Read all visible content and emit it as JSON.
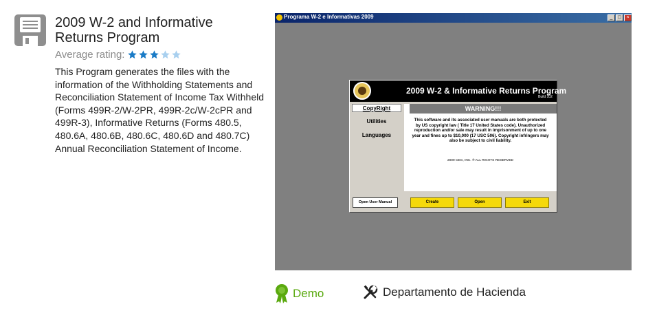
{
  "app": {
    "title": "2009 W-2 and Informative Returns Program",
    "rating_label": "Average rating:",
    "rating": 3,
    "rating_max": 5,
    "description": "This Program generates the files with the information of the Withholding Statements and Reconciliation Statement of Income Tax Withheld (Forms 499R-2/W-2PR, 499R-2c/W-2cPR and 499R-3), Informative Returns (Forms 480.5, 480.6A, 480.6B, 480.6C, 480.6D and 480.7C) Annual Reconciliation Statement of Income.",
    "icon": "floppy-disk-icon"
  },
  "screenshot": {
    "window_title": "Programa W-2 e Informativas 2009",
    "dialog_title": "2009 W-2 & Informative Returns Program",
    "build": "Build 102",
    "menu": [
      "CopyRight",
      "Utilities",
      "Languages"
    ],
    "warning_title": "WARNING!!!",
    "warning_text": "This software and its associated user manuals are both protected by US copyright law ( Title 17 United States code). Unauthorized reproduction and/or sale may result in imprisonment of up to one year and fines up to $10,000 (17 USC 506). Copyright infringers may also be subject to civil liability.",
    "copyright_footer": "2009 CEG, INC. ® ALL RIGHTS RESERVED",
    "buttons": {
      "open_manual": "Open User Manual",
      "create": "Create",
      "open": "Open",
      "exit": "Exit"
    }
  },
  "license": {
    "label": "Demo",
    "icon": "ribbon-badge-icon",
    "color": "#5aa90f"
  },
  "developer": {
    "label": "Departamento de Hacienda",
    "icon": "tools-icon"
  },
  "colors": {
    "star_filled": "#1a7bc6",
    "star_empty": "#a9d0ef",
    "preview_background": "#808080",
    "button_yellow": "#f5d90a"
  }
}
